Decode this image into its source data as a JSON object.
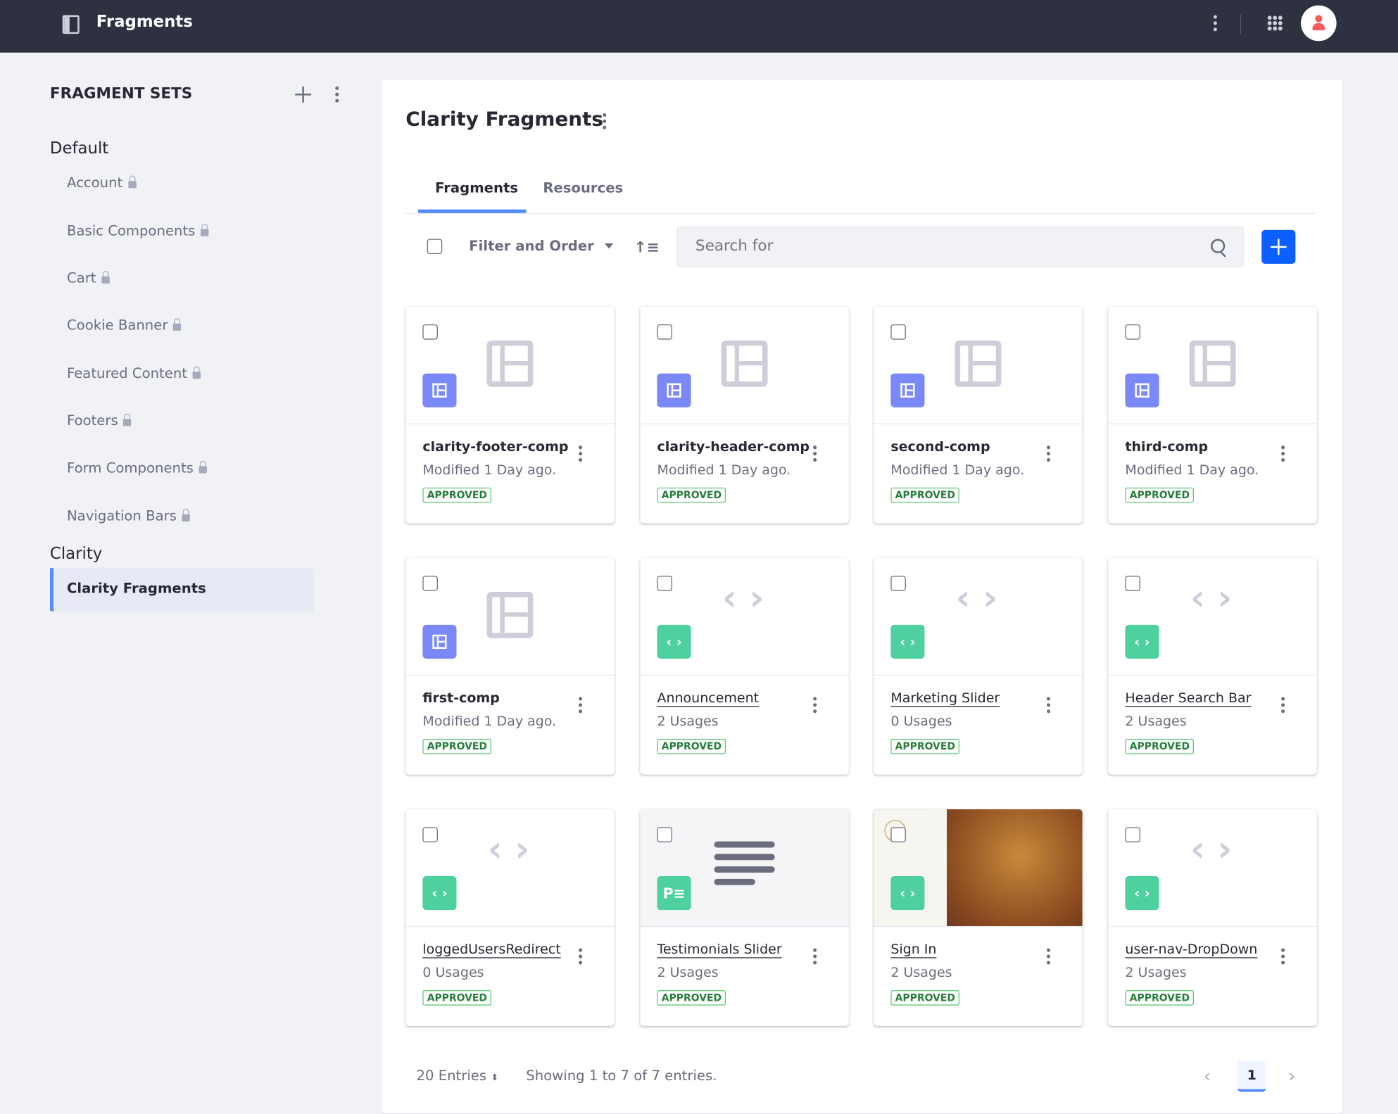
{
  "topbar": {
    "title": "Fragments"
  },
  "sidebar": {
    "title": "FRAGMENT SETS",
    "groups": [
      {
        "label": "Default",
        "items": [
          "Account",
          "Basic Components",
          "Cart",
          "Cookie Banner",
          "Featured Content",
          "Footers",
          "Form Components",
          "Navigation Bars"
        ]
      },
      {
        "label": "Clarity",
        "items": [
          "Clarity Fragments"
        ]
      }
    ]
  },
  "main": {
    "title": "Clarity Fragments",
    "tabs": [
      {
        "label": "Fragments",
        "active": true
      },
      {
        "label": "Resources",
        "active": false
      }
    ],
    "filter_label": "Filter and Order",
    "search_placeholder": "Search for",
    "cards": [
      {
        "name": "clarity-footer-comp",
        "sub": "Modified 1 Day ago.",
        "status": "APPROVED",
        "type": "layout"
      },
      {
        "name": "clarity-header-comp",
        "sub": "Modified 1 Day ago.",
        "status": "APPROVED",
        "type": "layout"
      },
      {
        "name": "second-comp",
        "sub": "Modified 1 Day ago.",
        "status": "APPROVED",
        "type": "layout"
      },
      {
        "name": "third-comp",
        "sub": "Modified 1 Day ago.",
        "status": "APPROVED",
        "type": "layout"
      },
      {
        "name": "first-comp",
        "sub": "Modified 1 Day ago.",
        "status": "APPROVED",
        "type": "layout"
      },
      {
        "name": "Announcement",
        "sub": "2 Usages",
        "status": "APPROVED",
        "type": "code"
      },
      {
        "name": "Marketing Slider",
        "sub": "0 Usages",
        "status": "APPROVED",
        "type": "code"
      },
      {
        "name": "Header Search Bar",
        "sub": "2 Usages",
        "status": "APPROVED",
        "type": "code"
      },
      {
        "name": "loggedUsersRedirect",
        "sub": "0 Usages",
        "status": "APPROVED",
        "type": "code"
      },
      {
        "name": "Testimonials Slider",
        "sub": "2 Usages",
        "status": "APPROVED",
        "type": "text"
      },
      {
        "name": "Sign In",
        "sub": "2 Usages",
        "status": "APPROVED",
        "type": "image"
      },
      {
        "name": "user-nav-DropDown",
        "sub": "2 Usages",
        "status": "APPROVED",
        "type": "code"
      }
    ],
    "footer": {
      "entries": "20 Entries",
      "showing": "Showing 1 to 7 of 7 entries.",
      "page": "1"
    }
  },
  "colors": {
    "accent": "#0b5fff",
    "layout_badge": "#7b88f8",
    "code_badge": "#4fd19f",
    "text_badge": "#4fd19f"
  }
}
